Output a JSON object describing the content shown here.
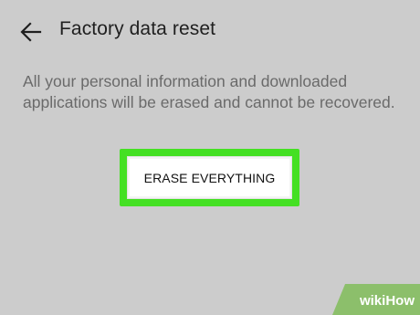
{
  "header": {
    "back_icon": "arrow-left-icon",
    "title": "Factory data reset"
  },
  "description": {
    "line1": "All your personal information and downloaded",
    "line2": "applications will be erased and cannot be recovered."
  },
  "actions": {
    "erase_label": "ERASE EVERYTHING",
    "highlight_color": "#44e023"
  },
  "watermark": {
    "wiki": "wiki",
    "how": "How"
  },
  "colors": {
    "background": "#cccccc",
    "title": "#1f1f1f",
    "description": "#6a6a6a",
    "button_bg": "#ffffff"
  }
}
